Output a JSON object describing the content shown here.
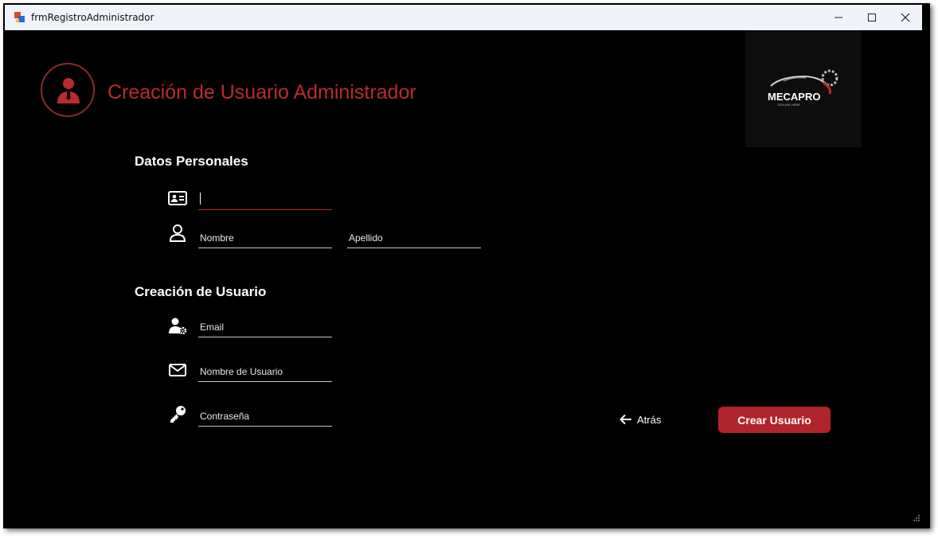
{
  "window": {
    "title": "frmRegistroAdministrador",
    "controls": [
      "minimize-icon",
      "maximize-icon",
      "close-icon"
    ]
  },
  "header": {
    "title": "Creación de Usuario Administrador",
    "icon": "admin-user-icon",
    "logo": {
      "brand": "MECAPRO",
      "tagline": "TAGLINE HERE"
    }
  },
  "personal": {
    "section_title": "Datos Personales",
    "id_field": {
      "value": "",
      "placeholder": "",
      "icon": "id-card-icon"
    },
    "name_field": {
      "placeholder": "Nombre",
      "icon": "user-icon"
    },
    "lastname_field": {
      "placeholder": "Apellido"
    }
  },
  "account": {
    "section_title": "Creación de Usuario",
    "email_field": {
      "placeholder": "Email",
      "icon": "user-settings-icon"
    },
    "username_field": {
      "placeholder": "Nombre de Usuario",
      "icon": "envelope-icon"
    },
    "password_field": {
      "placeholder": "Contraseña",
      "icon": "key-icon"
    }
  },
  "actions": {
    "back_label": "Atrás",
    "create_label": "Crear Usuario"
  },
  "colors": {
    "accent": "#b1242b",
    "background": "#000000",
    "text": "#ffffff"
  }
}
